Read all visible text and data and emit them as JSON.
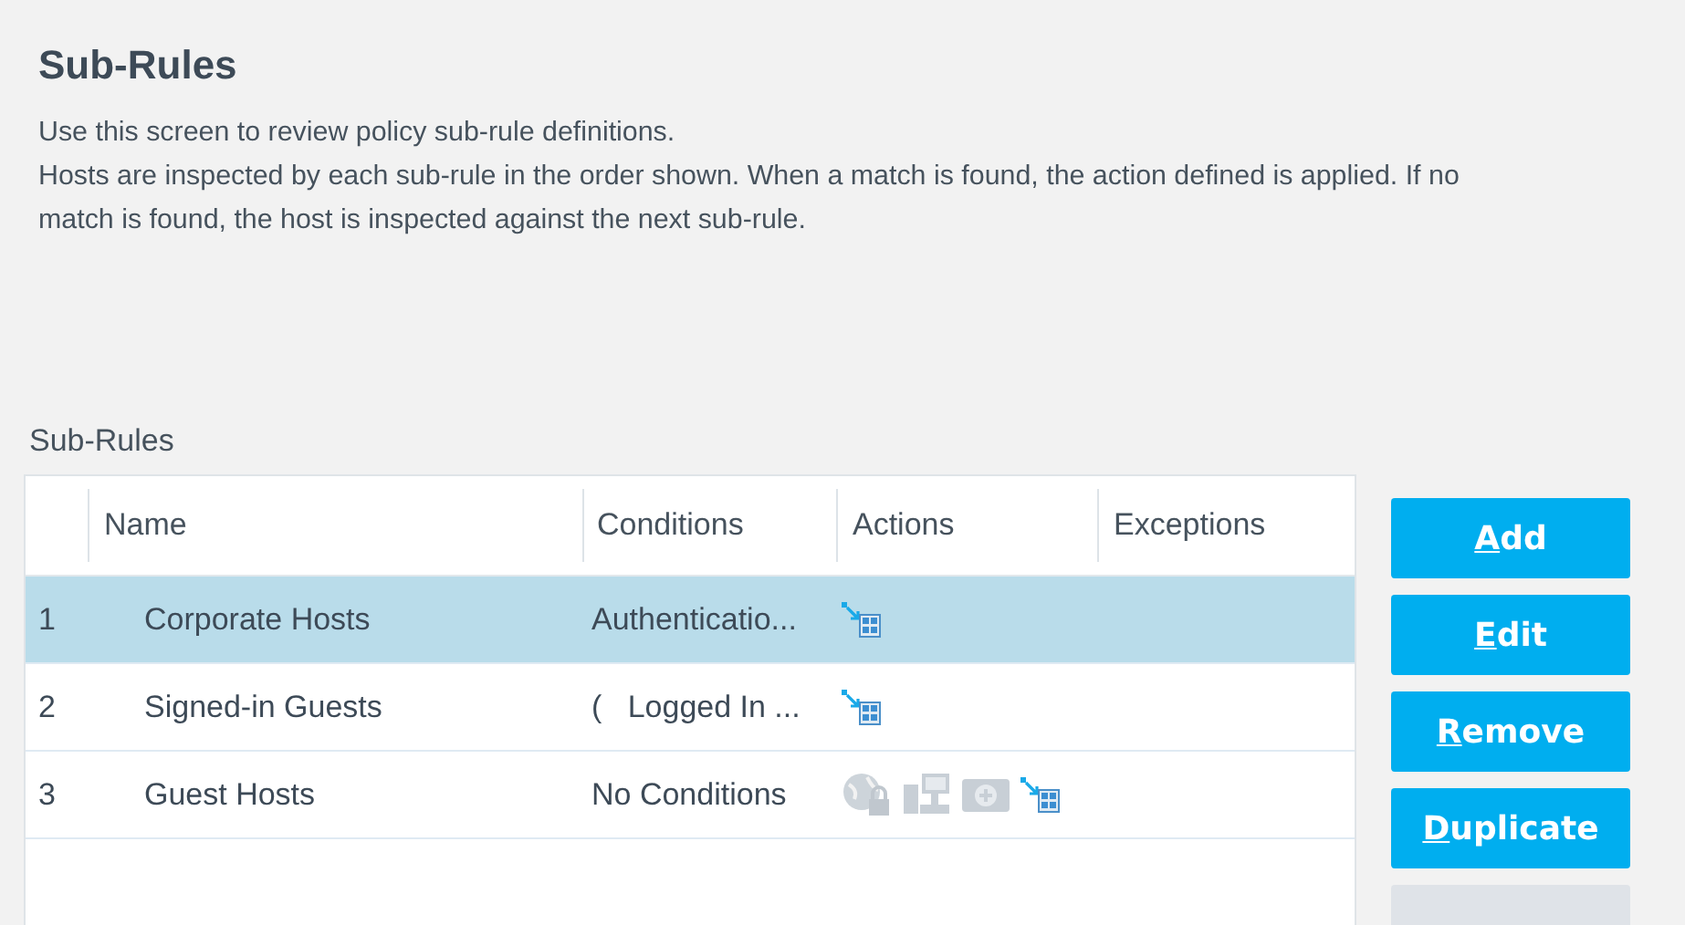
{
  "title": "Sub-Rules",
  "description": [
    "Use this screen to review policy sub-rule definitions.",
    "Hosts are inspected by each sub-rule in the order shown. When a match is found, the action defined is applied. If no match is found, the host is inspected against the next sub-rule."
  ],
  "table": {
    "label": "Sub-Rules",
    "columns": [
      "Name",
      "Conditions",
      "Actions",
      "Exceptions"
    ],
    "rows": [
      {
        "index": "1",
        "name": "Corporate Hosts",
        "conditions": "Authenticatio...",
        "actions": [
          {
            "kind": "assign"
          }
        ],
        "selected": true
      },
      {
        "index": "2",
        "name": "Signed-in Guests",
        "conditions": "(   Logged In ...",
        "actions": [
          {
            "kind": "assign"
          }
        ],
        "selected": false
      },
      {
        "index": "3",
        "name": "Guest Hosts",
        "conditions": "No Conditions",
        "actions": [
          {
            "kind": "globe-lock"
          },
          {
            "kind": "network"
          },
          {
            "kind": "plus"
          },
          {
            "kind": "assign"
          }
        ],
        "selected": false
      }
    ]
  },
  "buttons": [
    {
      "label": "Add",
      "underline_first": true,
      "disabled": false
    },
    {
      "label": "Edit",
      "underline_first": true,
      "disabled": false
    },
    {
      "label": "Remove",
      "underline_first": true,
      "disabled": false
    },
    {
      "label": "Duplicate",
      "underline_first": true,
      "disabled": false
    },
    {
      "disabled": true
    }
  ]
}
